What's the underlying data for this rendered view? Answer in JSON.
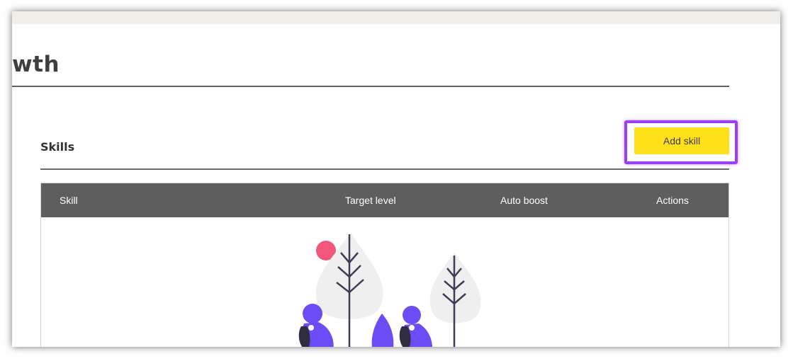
{
  "page": {
    "title": "wth"
  },
  "skills_section": {
    "title": "Skills",
    "add_button_label": "Add skill"
  },
  "table": {
    "columns": [
      "Skill",
      "Target level",
      "Auto boost",
      "Actions"
    ],
    "rows": []
  },
  "colors": {
    "accent_button": "#ffe01b",
    "highlight_outline": "#9b3ff5",
    "table_header": "#5e5e5e",
    "illustration_purple": "#6c4cf5",
    "illustration_pink": "#f0577a"
  },
  "icons": {
    "empty_state": "empty-state-illustration"
  }
}
